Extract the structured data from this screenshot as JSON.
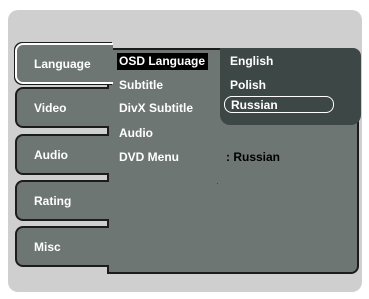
{
  "tabs": [
    {
      "label": "Language",
      "active": true
    },
    {
      "label": "Video",
      "active": false
    },
    {
      "label": "Audio",
      "active": false
    },
    {
      "label": "Rating",
      "active": false
    },
    {
      "label": "Misc",
      "active": false
    }
  ],
  "settings": {
    "osd_language": "OSD Language",
    "subtitle": "Subtitle",
    "divx_subtitle": "DivX Subtitle",
    "audio": "Audio",
    "dvd_menu": "DVD Menu",
    "dvd_menu_value": ": Russian"
  },
  "dropdown": {
    "options": [
      "English",
      "Polish",
      "Russian"
    ],
    "highlighted": "Russian"
  },
  "colors": {
    "panel": "#6e7674",
    "dropdown": "#3d4745",
    "frame": "#cfcfcf"
  }
}
